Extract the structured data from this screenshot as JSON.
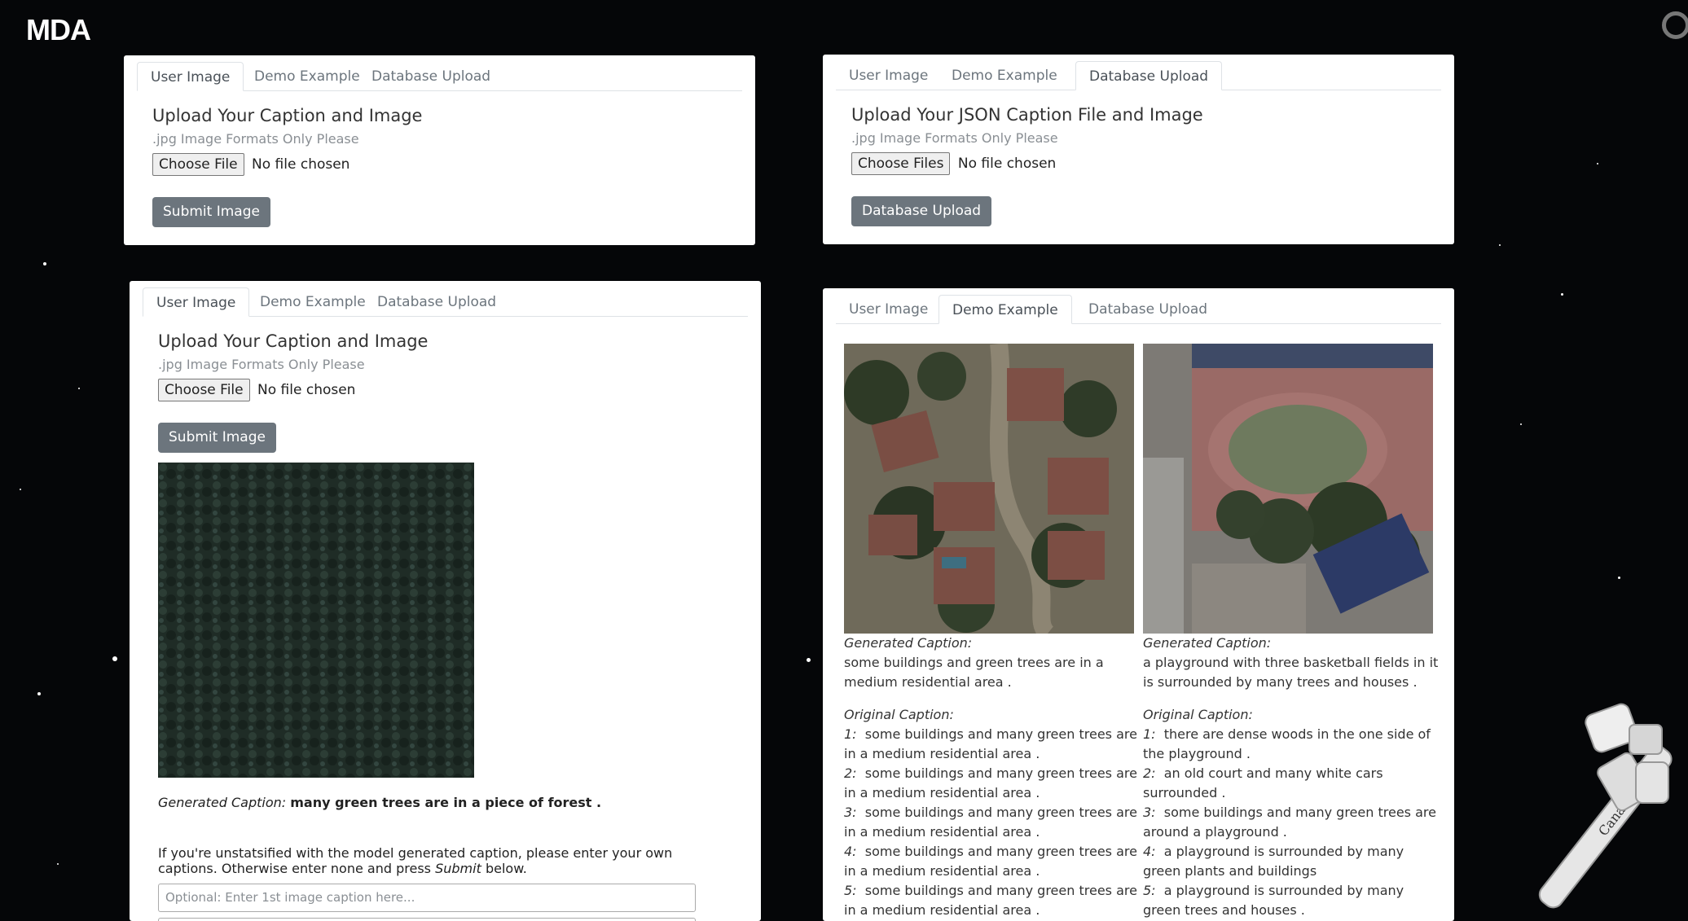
{
  "brand": "MDA",
  "canada": "Canada",
  "tabs": [
    "User Image",
    "Demo Example",
    "Database Upload"
  ],
  "user_panel": {
    "heading": "Upload Your Caption and Image",
    "hint": ".jpg Image Formats Only Please",
    "choose_label": "Choose File",
    "file_status": "No file chosen",
    "submit_label": "Submit Image"
  },
  "db_panel": {
    "heading": "Upload Your JSON Caption File and Image",
    "hint": ".jpg Image Formats Only Please",
    "choose_label": "Choose Files",
    "file_status": "No file chosen",
    "submit_label": "Database Upload"
  },
  "result_panel": {
    "generated_label": "Generated Caption:",
    "generated_text": "many green trees are in a piece of forest .",
    "instructions_pre": "If you're unstatsified with the model generated caption, please enter your own captions. Otherwise enter none and press",
    "instructions_em": "Submit",
    "instructions_post": "below.",
    "input_placeholder": "Optional: Enter 1st image caption here..."
  },
  "demo": {
    "generated_label": "Generated Caption:",
    "original_label": "Original Caption:",
    "items": [
      {
        "generated": "some buildings and green trees are in a medium residential area .",
        "originals": [
          {
            "n": "1:",
            "text": "some buildings and many green trees are in a medium residential area ."
          },
          {
            "n": "2:",
            "text": "some buildings and many green trees are in a medium residential area ."
          },
          {
            "n": "3:",
            "text": "some buildings and many green trees are in a medium residential area ."
          },
          {
            "n": "4:",
            "text": "some buildings and many green trees are in a medium residential area ."
          },
          {
            "n": "5:",
            "text": "some buildings and many green trees are in a medium residential area ."
          }
        ]
      },
      {
        "generated": "a playground with three basketball fields in it is surrounded by many trees and houses .",
        "originals": [
          {
            "n": "1:",
            "text": "there are dense woods in the one side of the playground ."
          },
          {
            "n": "2:",
            "text": "an old court and many white cars surrounded ."
          },
          {
            "n": "3:",
            "text": "some buildings and many green trees are around a playground ."
          },
          {
            "n": "4:",
            "text": "a playground is surrounded by many green plants and buildings"
          },
          {
            "n": "5:",
            "text": "a playground is surrounded by many green trees and houses ."
          }
        ]
      }
    ]
  }
}
